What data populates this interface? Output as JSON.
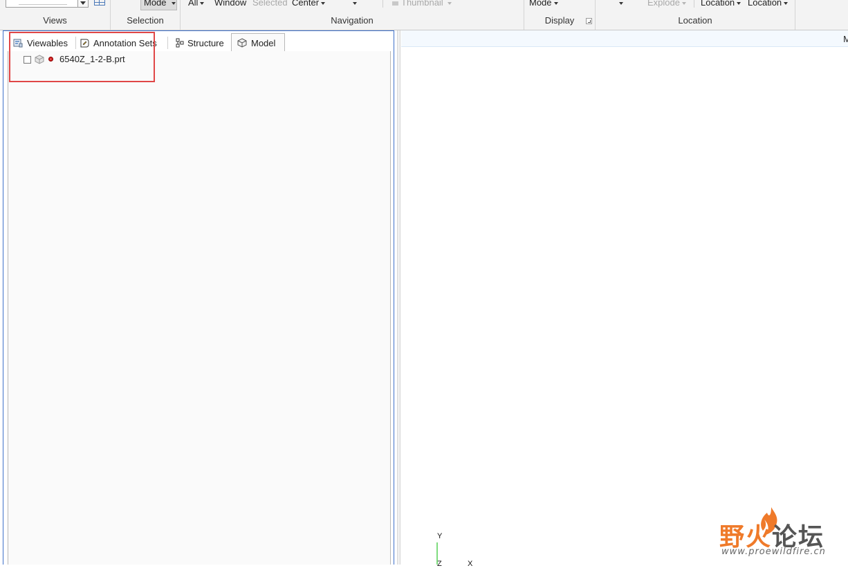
{
  "ribbon": {
    "views_label": "Views",
    "selection": {
      "mode_label": "Mode",
      "group_label": "Selection"
    },
    "navigation": {
      "all_label": "All",
      "window_label": "Window",
      "selected_label": "Selected",
      "center_label": "Center",
      "thumbnail_label": "Thumbnail",
      "group_label": "Navigation"
    },
    "display": {
      "mode_label": "Mode",
      "group_label": "Display"
    },
    "location": {
      "explode_label": "Explode",
      "location1_label": "Location",
      "location2_label": "Location",
      "group_label": "Location"
    }
  },
  "left_panel": {
    "tabs": [
      {
        "label": "Viewables",
        "icon": "viewables-icon"
      },
      {
        "label": "Annotation Sets",
        "icon": "annotation-sets-icon"
      },
      {
        "label": "Structure",
        "icon": "structure-icon"
      },
      {
        "label": "Model",
        "icon": "model-cube-icon",
        "active": true
      }
    ],
    "tree": [
      {
        "label": "6540Z_1-2-B.prt",
        "checked": false,
        "icon": "part-icon",
        "status_color": "#d42020"
      }
    ]
  },
  "viewport": {
    "header_text": "M",
    "axis": {
      "y": "Y",
      "x": "X",
      "z": "Z"
    }
  },
  "watermark": {
    "title_part1": "野火",
    "title_part2": "论坛",
    "url": "www.proewildfire.cn"
  },
  "colors": {
    "panel_border": "#3d6fc9",
    "highlight": "#e04646",
    "watermark_orange": "#ef7a2a",
    "axis_green": "#7fdc7f"
  }
}
